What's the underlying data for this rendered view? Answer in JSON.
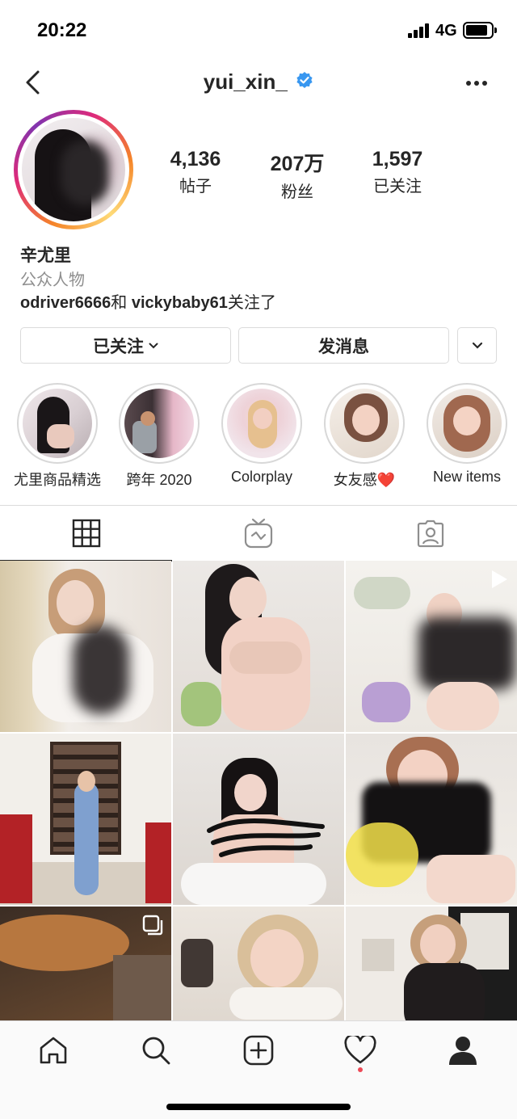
{
  "status_bar": {
    "time": "20:22",
    "network": "4G"
  },
  "header": {
    "username": "yui_xin_"
  },
  "profile": {
    "stats": [
      {
        "value": "4,136",
        "label": "帖子"
      },
      {
        "value": "207万",
        "label": "粉丝"
      },
      {
        "value": "1,597",
        "label": "已关注"
      }
    ],
    "name": "辛尤里",
    "category": "公众人物",
    "followed_by": {
      "user1": "odriver6666",
      "connector": "和",
      "user2": "vickybaby61",
      "suffix": "关注了"
    }
  },
  "actions": {
    "following_label": "已关注",
    "message_label": "发消息"
  },
  "highlights": [
    {
      "label": "尤里商品精选"
    },
    {
      "label": "跨年 2020"
    },
    {
      "label": "Colorplay"
    },
    {
      "label": "女友感❤️"
    },
    {
      "label": "New items"
    }
  ],
  "tabs": [
    {
      "icon": "grid-icon",
      "active": true
    },
    {
      "icon": "igtv-icon",
      "active": false
    },
    {
      "icon": "tagged-icon",
      "active": false
    }
  ],
  "nav": [
    "home-icon",
    "search-icon",
    "new-post-icon",
    "activity-icon",
    "profile-icon"
  ],
  "colors": {
    "verified": "#3897f0",
    "ring_start": "#f58529",
    "ring_end": "#dd2a7b",
    "notif_dot": "#ed4956"
  }
}
